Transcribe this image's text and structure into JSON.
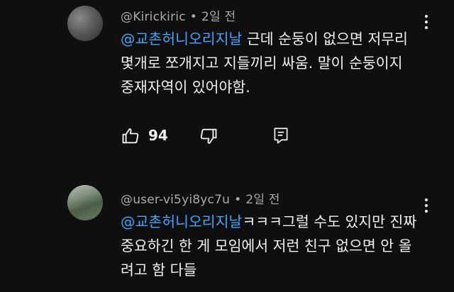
{
  "comments": [
    {
      "username": "@Kirickiric",
      "separator": "•",
      "time": "2일 전",
      "mention": "@교촌허니오리지날",
      "text": " 근데 순둥이 없으면 저무리 몇개로 쪼개지고 지들끼리 싸움. 말이 순둥이지 중재자역이 있어야함.",
      "like_count": "94",
      "icons": {
        "like": "thumbs-up-icon",
        "dislike": "thumbs-down-icon",
        "reply": "reply-icon",
        "menu": "more-vert-icon"
      }
    },
    {
      "username": "@user-vi5yi8yc7u",
      "separator": "•",
      "time": "2일 전",
      "mention": "@교촌허니오리지날",
      "text": "ㅋㅋㅋ그럴 수도 있지만 진짜 중요하긴 한 게 모임에서 저런 친구 없으면 안 올려고 함 다들",
      "icons": {
        "menu": "more-vert-icon"
      }
    }
  ],
  "colors": {
    "background": "#0f0f0f",
    "text": "#f1f1f1",
    "meta": "#aaaaaa",
    "mention": "#3ea6ff"
  }
}
